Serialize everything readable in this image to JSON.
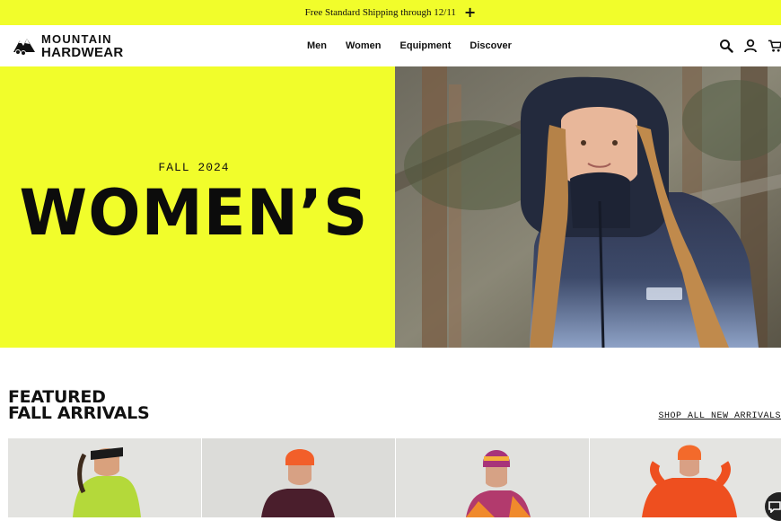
{
  "promo": {
    "text": "Free Standard Shipping through 12/11",
    "expand_icon": "plus-icon"
  },
  "header": {
    "logo": {
      "line1": "MOUNTAIN",
      "line2": "HARDWEAR"
    },
    "nav": [
      {
        "label": "Men"
      },
      {
        "label": "Women"
      },
      {
        "label": "Equipment"
      },
      {
        "label": "Discover"
      }
    ],
    "icons": [
      "search-icon",
      "account-icon",
      "cart-icon"
    ]
  },
  "hero": {
    "season": "FALL 2024",
    "title": "WOMEN’S"
  },
  "featured": {
    "title_line1": "FEATURED",
    "title_line2": "FALL ARRIVALS",
    "shop_all": "SHOP ALL NEW ARRIVALS"
  },
  "chat": {
    "icon": "chat-icon"
  },
  "colors": {
    "accent": "#f1fd2b",
    "text": "#111111"
  }
}
